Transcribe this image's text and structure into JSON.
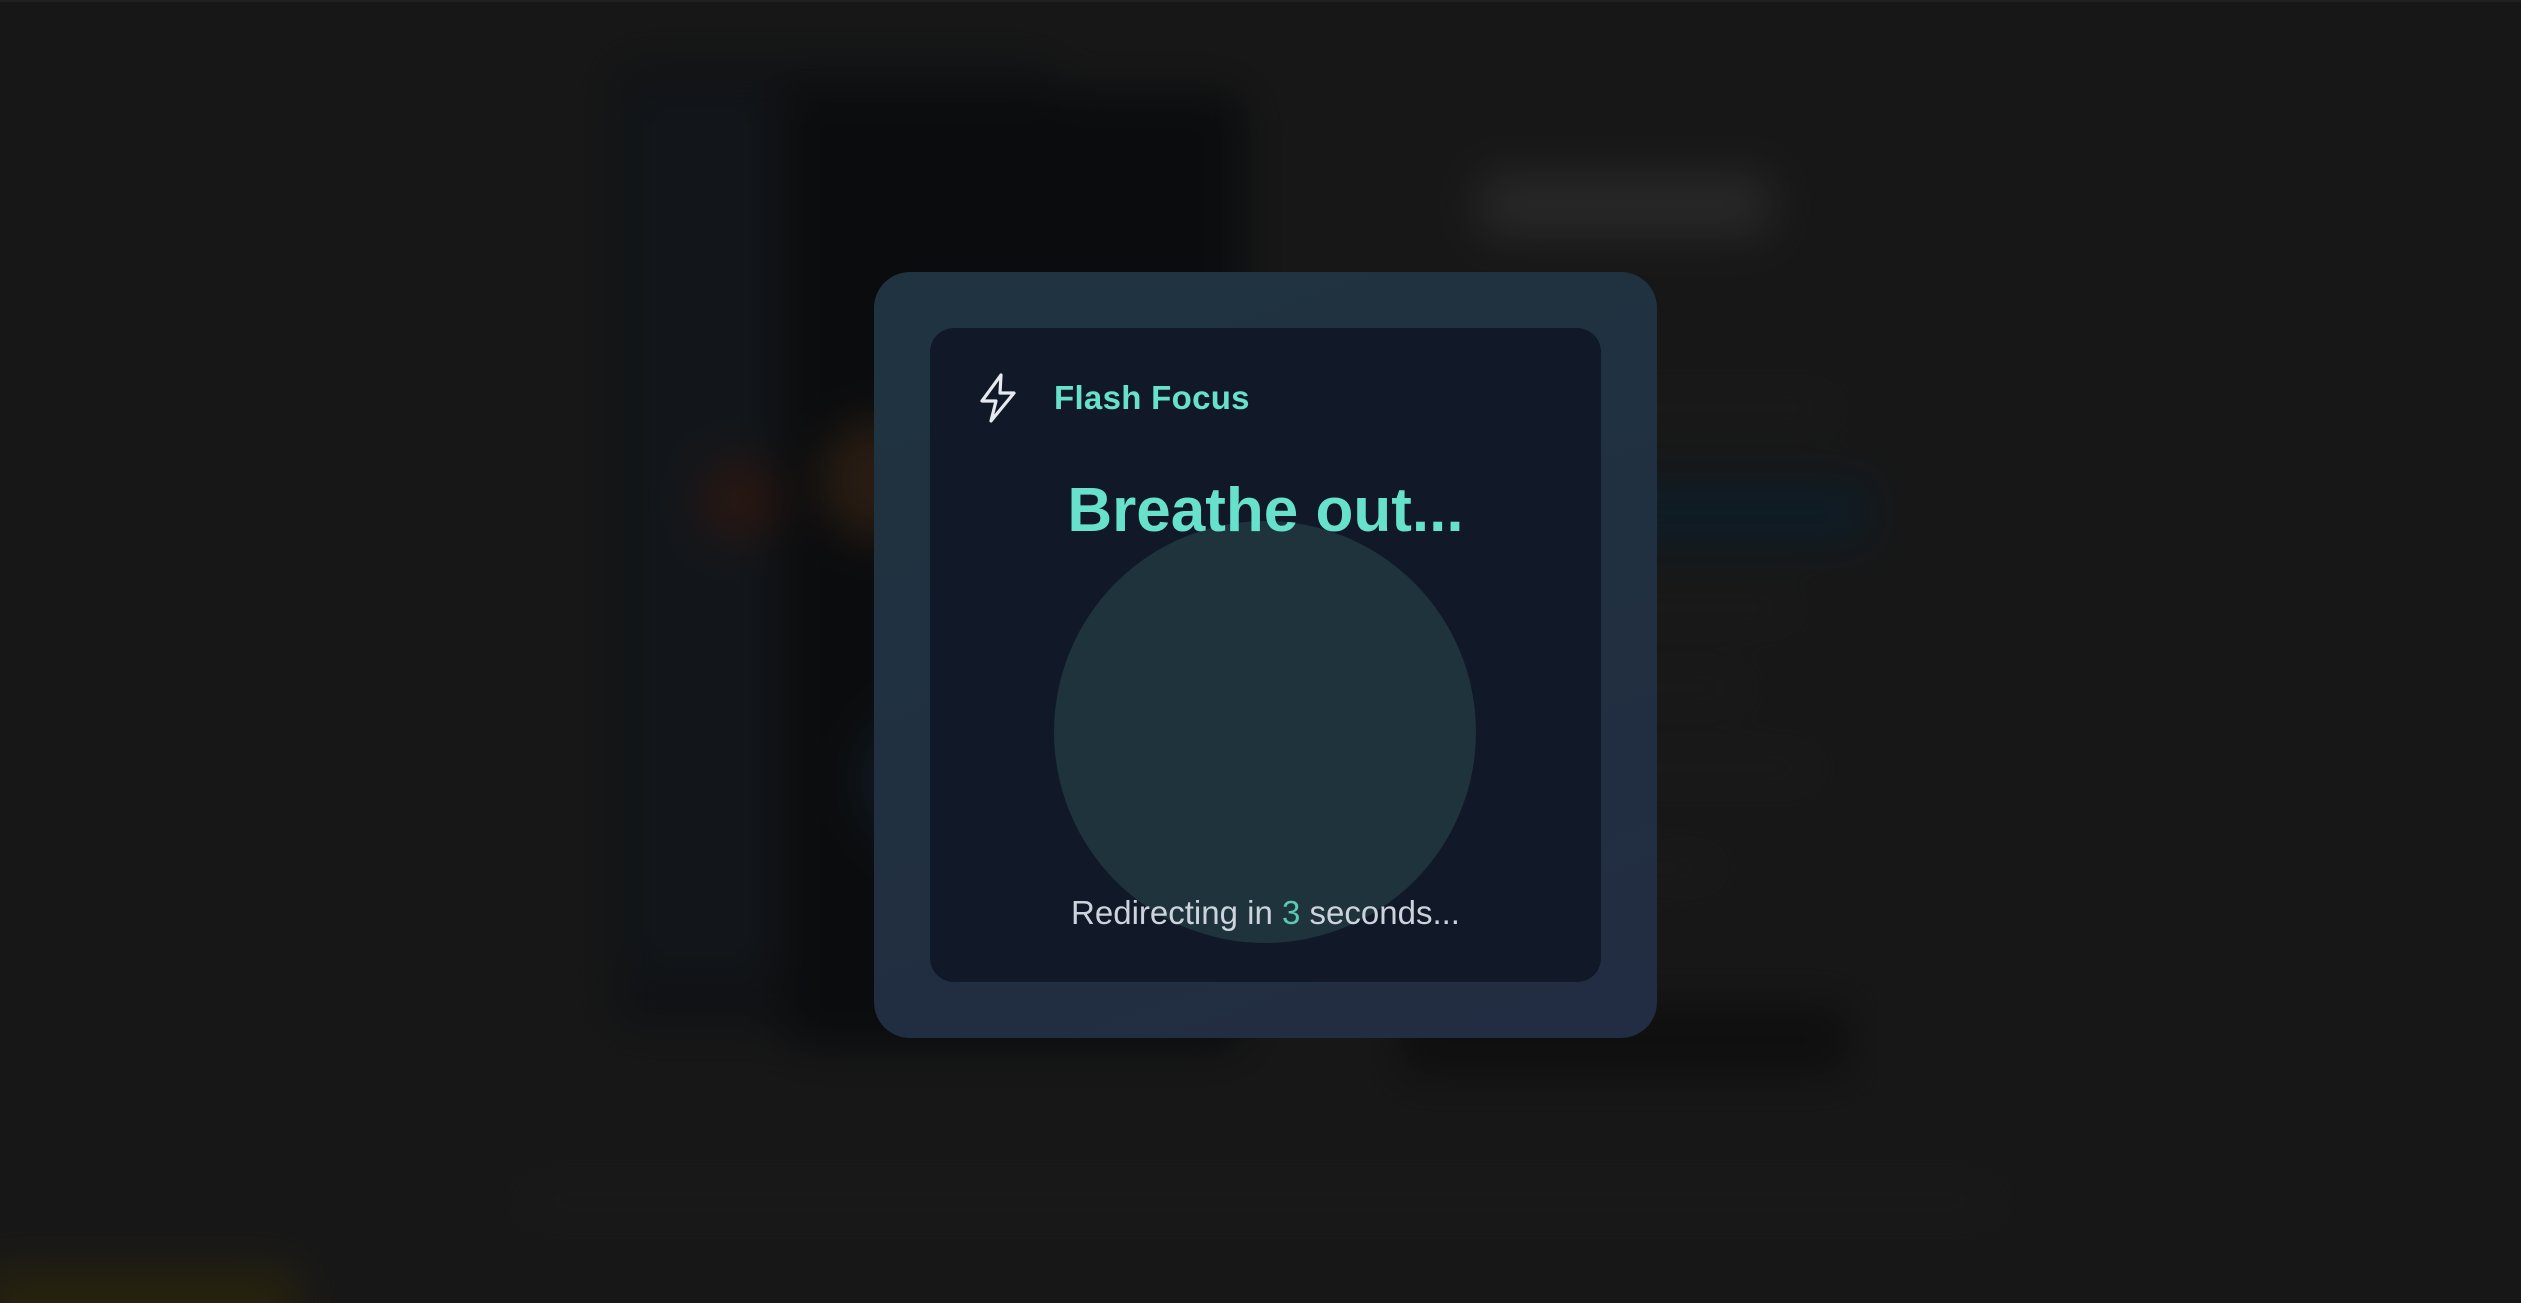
{
  "modal": {
    "brand": {
      "icon": "lightning-bolt-icon",
      "name": "Flash Focus"
    },
    "headline": "Breathe out...",
    "redirect": {
      "prefix": "Redirecting in",
      "seconds": "3",
      "suffix": "seconds..."
    }
  },
  "colors": {
    "accent": "#67e0cc",
    "countdown": "#5cc9b8",
    "card_background": "#111827",
    "frame_background": "#1f3440",
    "breath_circle": "#1e333b",
    "page_background": "#1b1b1b"
  }
}
